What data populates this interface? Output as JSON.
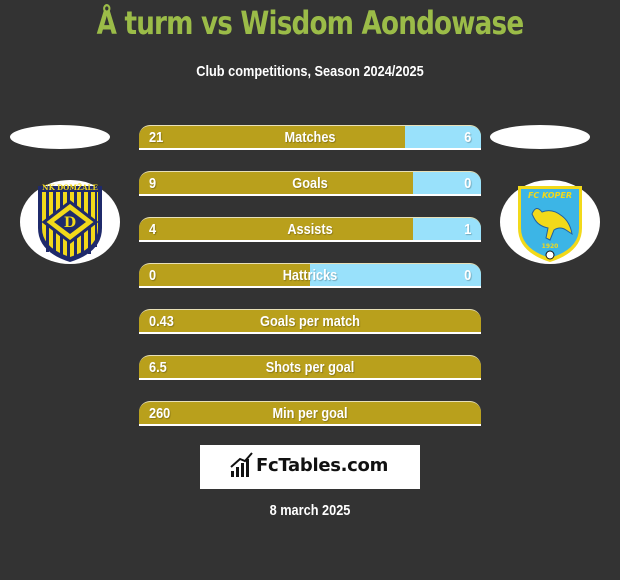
{
  "header": {
    "title": "Å turm vs Wisdom Aondowase",
    "subtitle": "Club competitions, Season 2024/2025"
  },
  "teams": {
    "left": {
      "logo_icon": "nk-domzale-crest-icon",
      "logo_text": "NK DOMŽALE"
    },
    "right": {
      "logo_icon": "fc-koper-crest-icon",
      "logo_text": "FC KOPER",
      "logo_year": "1920"
    }
  },
  "colors": {
    "left_bar": "#b9a01c",
    "right_bar": "#99e1fb",
    "title": "#9bbc48",
    "background": "#333333"
  },
  "stats": [
    {
      "label": "Matches",
      "left": "21",
      "right": "6",
      "left_share": 0.7778
    },
    {
      "label": "Goals",
      "left": "9",
      "right": "0",
      "left_share": 0.8
    },
    {
      "label": "Assists",
      "left": "4",
      "right": "1",
      "left_share": 0.8
    },
    {
      "label": "Hattricks",
      "left": "0",
      "right": "0",
      "left_share": 0.5
    },
    {
      "label": "Goals per match",
      "left": "0.43",
      "right": "",
      "left_share": 1
    },
    {
      "label": "Shots per goal",
      "left": "6.5",
      "right": "",
      "left_share": 1
    },
    {
      "label": "Min per goal",
      "left": "260",
      "right": "",
      "left_share": 1
    }
  ],
  "brand": {
    "name": "FcTables.com",
    "icon": "bar-chart-icon"
  },
  "date": "8 march 2025"
}
